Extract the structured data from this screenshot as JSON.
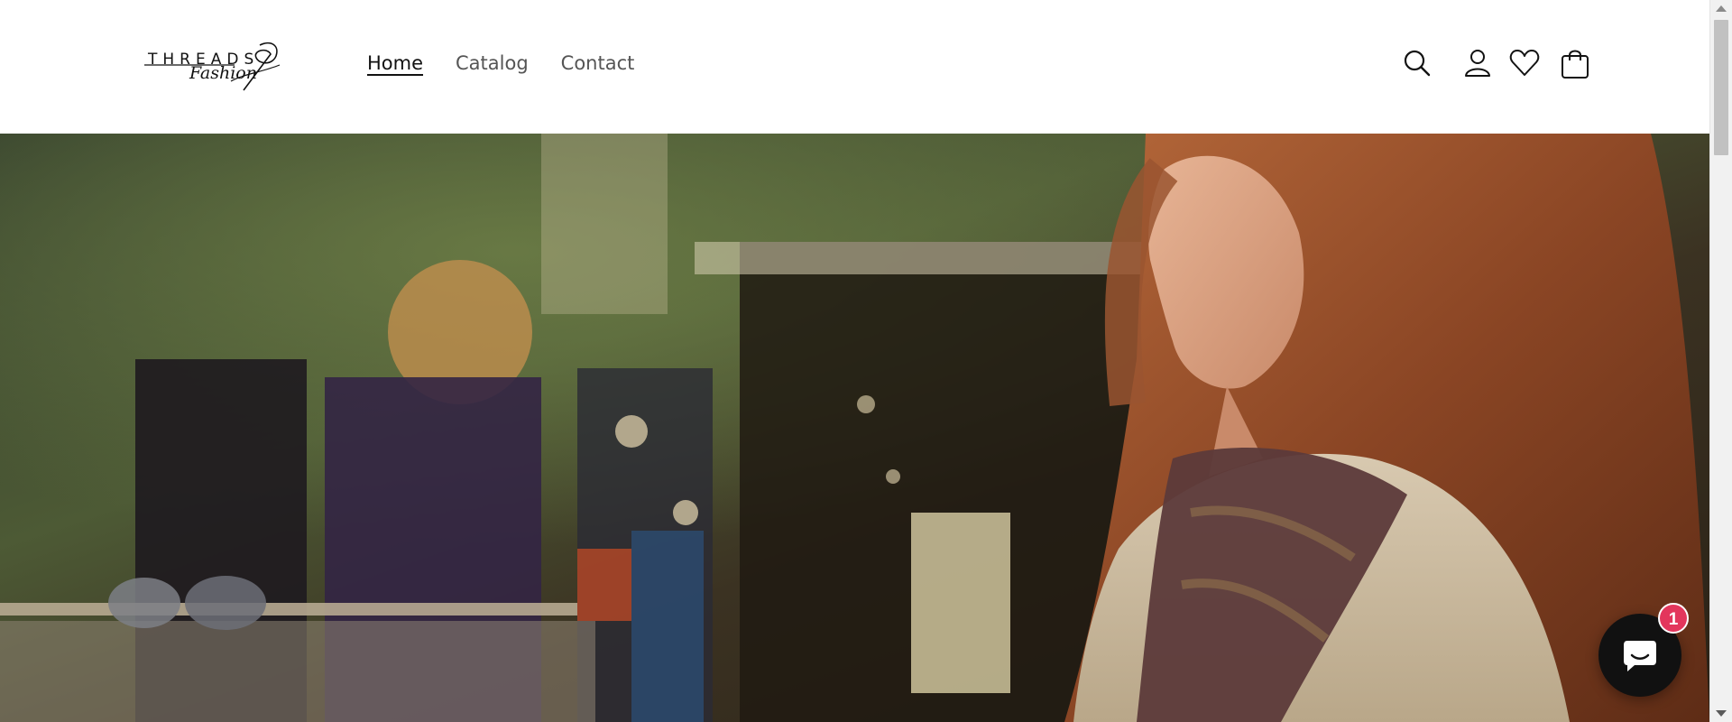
{
  "brand": {
    "logo_word": "THREADS",
    "logo_script": "Fashion"
  },
  "nav": {
    "items": [
      {
        "label": "Home",
        "active": true
      },
      {
        "label": "Catalog",
        "active": false
      },
      {
        "label": "Contact",
        "active": false
      }
    ]
  },
  "header_icons": [
    "search-icon",
    "account-icon",
    "wishlist-icon",
    "cart-icon"
  ],
  "hero": {
    "image": "woman-shopping-boutique-photo"
  },
  "chat": {
    "icon": "chat-bubble-icon",
    "badge_count": "1",
    "badge_color": "#e3365c"
  },
  "colors": {
    "text_primary": "#121212",
    "text_muted": "#555555",
    "chat_bg": "#111111"
  }
}
